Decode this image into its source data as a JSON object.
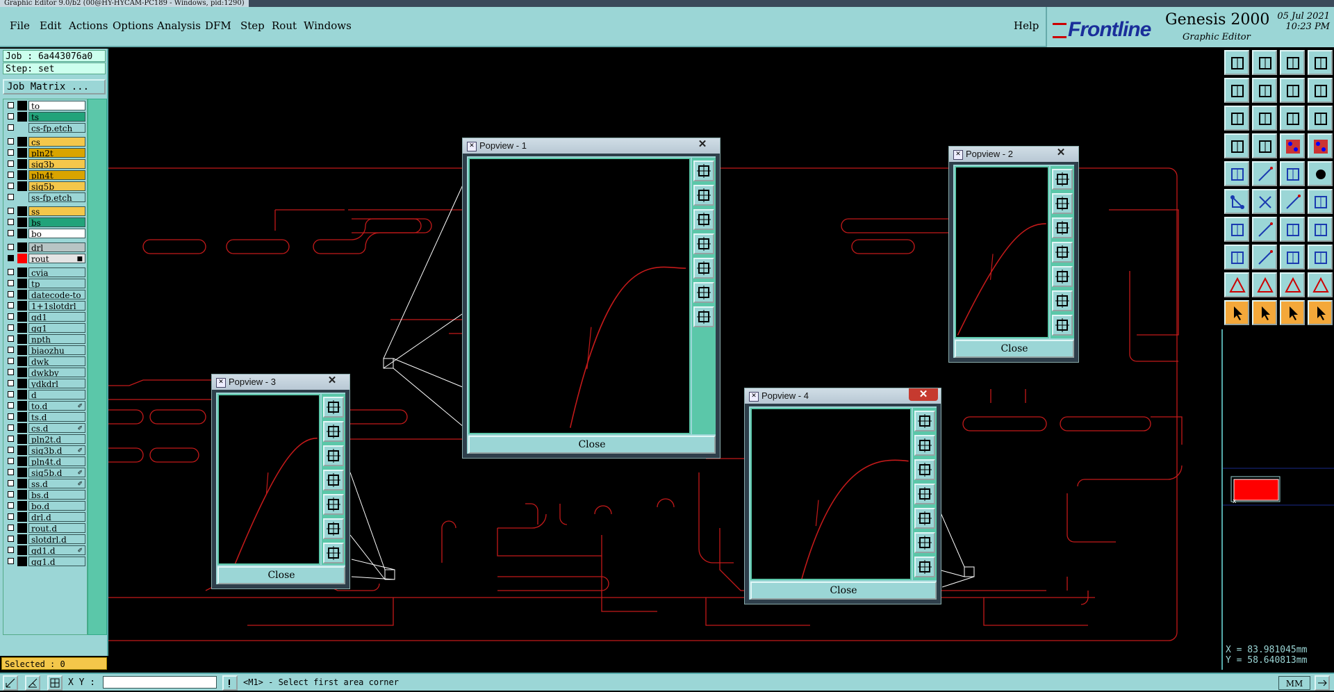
{
  "window": {
    "title": "Graphic Editor 9.0/b2 (00@HY-HYCAM-PC189 - Windows, pid:1290)"
  },
  "menu": {
    "items": [
      "File",
      "Edit",
      "Actions",
      "Options",
      "Analysis",
      "DFM",
      "Step",
      "Rout",
      "Windows"
    ],
    "help": "Help"
  },
  "brand": {
    "logo": "Frontline",
    "product": "Genesis 2000",
    "subtitle": "Graphic Editor",
    "date": "05 Jul 2021",
    "time": "10:23 PM"
  },
  "job": {
    "label": "Job : 6a443076a0",
    "step": "Step: set",
    "matrix_button": "Job Matrix ..."
  },
  "layers": [
    {
      "name": "to",
      "color": "#ffffff",
      "swatch": "#000000"
    },
    {
      "name": "ts",
      "color": "#22a37a",
      "swatch": "#000000"
    },
    {
      "name": "cs-fp.etch",
      "color": "#9bd6d6",
      "swatch": "#9bd6d6"
    },
    {
      "name": "cs",
      "color": "#f4c74a",
      "swatch": "#000000"
    },
    {
      "name": "pln2t",
      "color": "#d9a400",
      "swatch": "#000000"
    },
    {
      "name": "sig3b",
      "color": "#f4c74a",
      "swatch": "#000000"
    },
    {
      "name": "pln4t",
      "color": "#d9a400",
      "swatch": "#000000"
    },
    {
      "name": "sig5b",
      "color": "#f4c74a",
      "swatch": "#000000"
    },
    {
      "name": "ss-fp.etch",
      "color": "#9bd6d6",
      "swatch": "#9bd6d6"
    },
    {
      "name": "ss",
      "color": "#f4c74a",
      "swatch": "#000000"
    },
    {
      "name": "bs",
      "color": "#22a37a",
      "swatch": "#000000"
    },
    {
      "name": "bo",
      "color": "#ffffff",
      "swatch": "#000000"
    },
    {
      "name": "drl",
      "color": "#b8c4c4",
      "swatch": "#000000"
    },
    {
      "name": "rout",
      "color": "#e4e4e4",
      "swatch": "#ff0000"
    },
    {
      "name": "cvia",
      "color": "#9bd6d6",
      "swatch": "#000000"
    },
    {
      "name": "tp",
      "color": "#9bd6d6",
      "swatch": "#000000"
    },
    {
      "name": "datecode-to",
      "color": "#9bd6d6",
      "swatch": "#000000"
    },
    {
      "name": "1+1slotdrl",
      "color": "#9bd6d6",
      "swatch": "#000000"
    },
    {
      "name": "gd1",
      "color": "#9bd6d6",
      "swatch": "#000000"
    },
    {
      "name": "gg1",
      "color": "#9bd6d6",
      "swatch": "#000000"
    },
    {
      "name": "npth",
      "color": "#9bd6d6",
      "swatch": "#000000"
    },
    {
      "name": "biaozhu",
      "color": "#9bd6d6",
      "swatch": "#000000"
    },
    {
      "name": "dwk",
      "color": "#9bd6d6",
      "swatch": "#000000"
    },
    {
      "name": "dwkby",
      "color": "#9bd6d6",
      "swatch": "#000000"
    },
    {
      "name": "ydkdrl",
      "color": "#9bd6d6",
      "swatch": "#000000"
    },
    {
      "name": "d",
      "color": "#9bd6d6",
      "swatch": "#000000"
    },
    {
      "name": "to.d",
      "color": "#9bd6d6",
      "swatch": "#000000",
      "flag": true
    },
    {
      "name": "ts.d",
      "color": "#9bd6d6",
      "swatch": "#000000"
    },
    {
      "name": "cs.d",
      "color": "#9bd6d6",
      "swatch": "#000000",
      "flag": true
    },
    {
      "name": "pln2t.d",
      "color": "#9bd6d6",
      "swatch": "#000000"
    },
    {
      "name": "sig3b.d",
      "color": "#9bd6d6",
      "swatch": "#000000",
      "flag": true
    },
    {
      "name": "pln4t.d",
      "color": "#9bd6d6",
      "swatch": "#000000"
    },
    {
      "name": "sig5b.d",
      "color": "#9bd6d6",
      "swatch": "#000000",
      "flag": true
    },
    {
      "name": "ss.d",
      "color": "#9bd6d6",
      "swatch": "#000000",
      "flag": true
    },
    {
      "name": "bs.d",
      "color": "#9bd6d6",
      "swatch": "#000000"
    },
    {
      "name": "bo.d",
      "color": "#9bd6d6",
      "swatch": "#000000"
    },
    {
      "name": "drl.d",
      "color": "#9bd6d6",
      "swatch": "#000000"
    },
    {
      "name": "rout.d",
      "color": "#9bd6d6",
      "swatch": "#000000"
    },
    {
      "name": "slotdrl.d",
      "color": "#9bd6d6",
      "swatch": "#000000"
    },
    {
      "name": "gd1.d",
      "color": "#9bd6d6",
      "swatch": "#000000",
      "flag": true
    },
    {
      "name": "gg1.d",
      "color": "#9bd6d6",
      "swatch": "#000000"
    }
  ],
  "selected": "Selected : 0",
  "popviews": [
    {
      "title": "Popview - 1",
      "close": "Close"
    },
    {
      "title": "Popview - 2",
      "close": "Close"
    },
    {
      "title": "Popview - 3",
      "close": "Close"
    },
    {
      "title": "Popview - 4",
      "close": "Close"
    }
  ],
  "coords": {
    "x": "X = 83.981045mm",
    "y": "Y = 58.640813mm"
  },
  "status": {
    "xy_label": "X Y :",
    "xy_value": "",
    "prompt": "<M1> - Select first area corner",
    "units": "MM"
  },
  "colors": {
    "panel": "#9bd6d6",
    "accent": "#5bc7a9",
    "rout": "#ff0000",
    "profile": "#c41a1a"
  }
}
